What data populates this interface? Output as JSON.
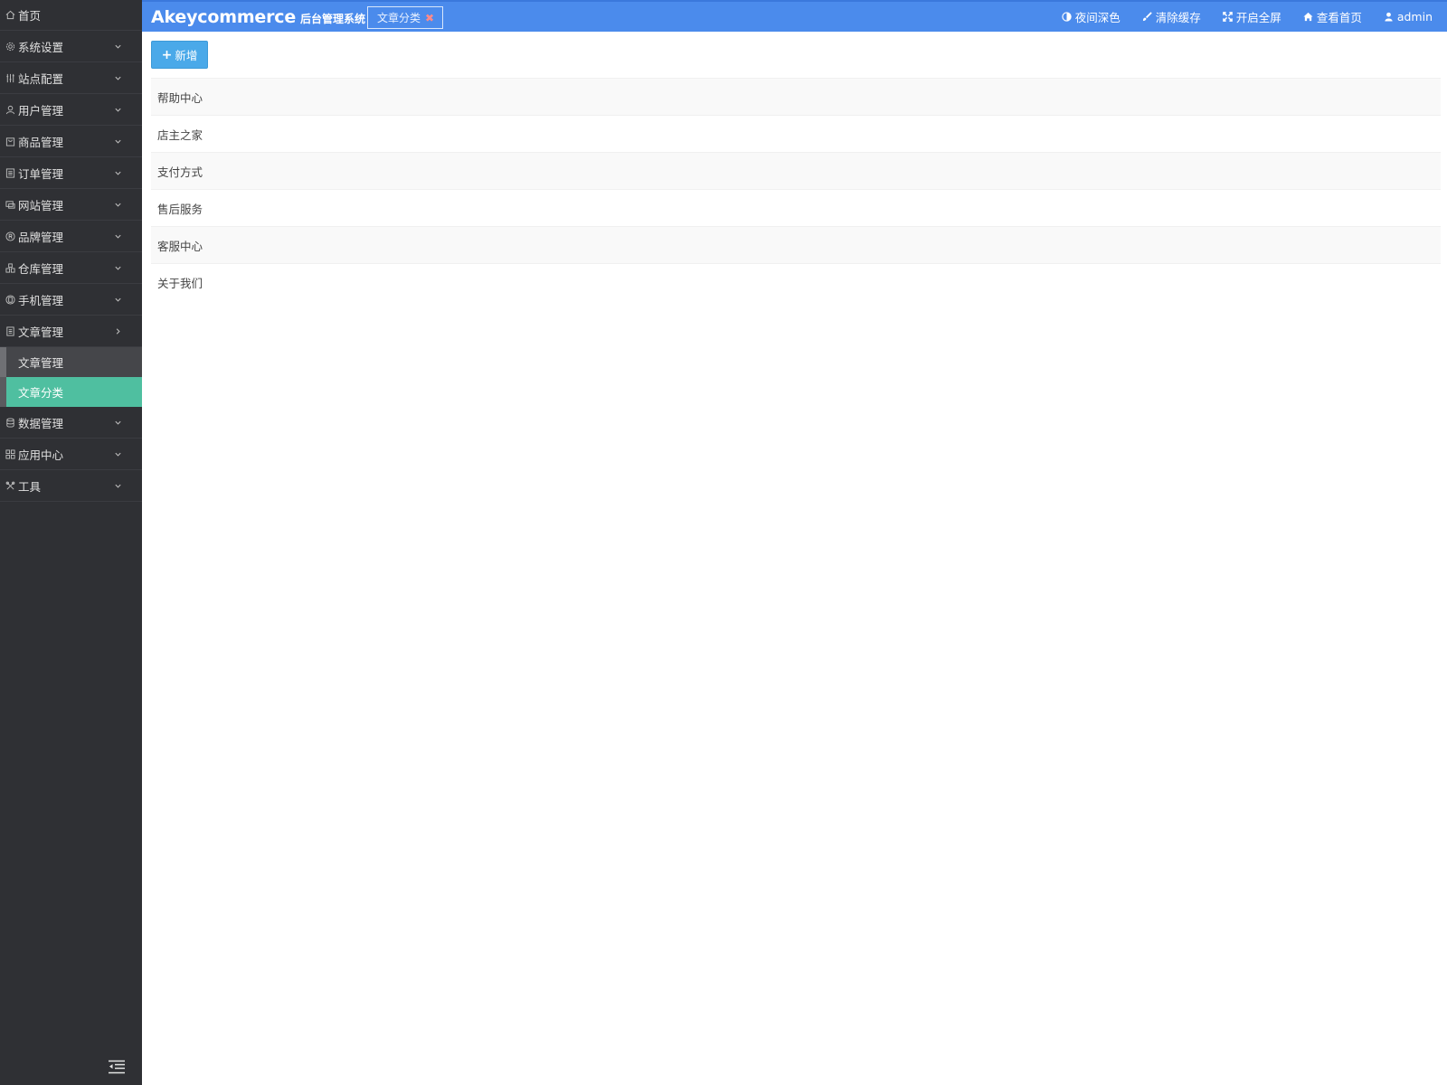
{
  "sidebar": {
    "home": {
      "label": "首页",
      "icon": "home-icon"
    },
    "items": [
      {
        "label": "系统设置",
        "icon": "gear-icon"
      },
      {
        "label": "站点配置",
        "icon": "sliders-icon"
      },
      {
        "label": "用户管理",
        "icon": "user-icon"
      },
      {
        "label": "商品管理",
        "icon": "bag-icon"
      },
      {
        "label": "订单管理",
        "icon": "list-icon"
      },
      {
        "label": "网站管理",
        "icon": "web-icon"
      },
      {
        "label": "品牌管理",
        "icon": "registered-icon"
      },
      {
        "label": "仓库管理",
        "icon": "boxes-icon"
      },
      {
        "label": "手机管理",
        "icon": "mobile-icon"
      },
      {
        "label": "文章管理",
        "icon": "document-icon"
      }
    ],
    "submenu": [
      {
        "label": "文章管理"
      },
      {
        "label": "文章分类",
        "active": true
      }
    ],
    "items_after": [
      {
        "label": "数据管理",
        "icon": "database-icon"
      },
      {
        "label": "应用中心",
        "icon": "grid-icon"
      },
      {
        "label": "工具",
        "icon": "tools-icon"
      }
    ]
  },
  "header": {
    "brand": "Akeycommerce",
    "brand_sub": "后台管理系统",
    "tab_label": "文章分类",
    "tools": [
      {
        "label": "夜间深色",
        "icon": "contrast-icon"
      },
      {
        "label": "清除缓存",
        "icon": "brush-icon"
      },
      {
        "label": "开启全屏",
        "icon": "fullscreen-icon"
      },
      {
        "label": "查看首页",
        "icon": "home-icon"
      },
      {
        "label": "admin",
        "icon": "user-icon"
      }
    ]
  },
  "main": {
    "add_label": "新增",
    "rows": [
      "帮助中心",
      "店主之家",
      "支付方式",
      "售后服务",
      "客服中心",
      "关于我们"
    ]
  },
  "colors": {
    "sidebar_bg": "#2f3034",
    "header_bg": "#4b8bec",
    "active_item": "#4fbfa0",
    "add_button": "#4aa9e9"
  }
}
